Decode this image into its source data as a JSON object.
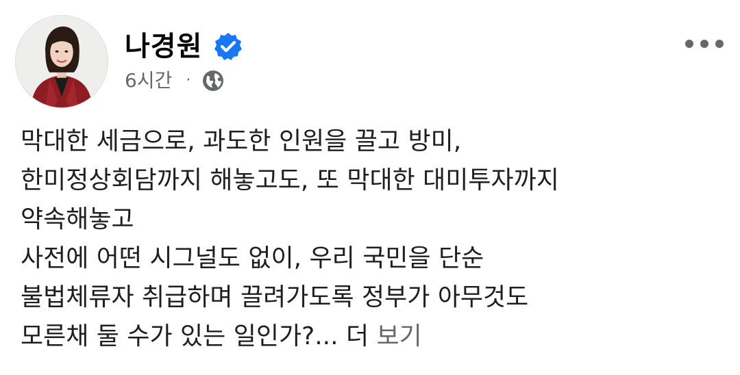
{
  "author": {
    "name": "나경원",
    "verified_icon": "verified-badge-icon"
  },
  "meta": {
    "timestamp": "6시간",
    "separator": "·",
    "audience_icon": "globe-icon"
  },
  "post": {
    "lines": [
      "막대한 세금으로, 과도한 인원을 끌고 방미,",
      "한미정상회담까지 해놓고도, 또 막대한 대미투자까지",
      "약속해놓고",
      "사전에 어떤 시그널도 없이, 우리 국민을 단순",
      "불법체류자 취급하며 끌려가도록 정부가 아무것도",
      "모른채 둘 수가 있는 일인가?... 더 "
    ],
    "see_more": "보기"
  },
  "colors": {
    "verified": "#1877f2",
    "secondary_text": "#65676b",
    "primary_text": "#1c1e21"
  }
}
